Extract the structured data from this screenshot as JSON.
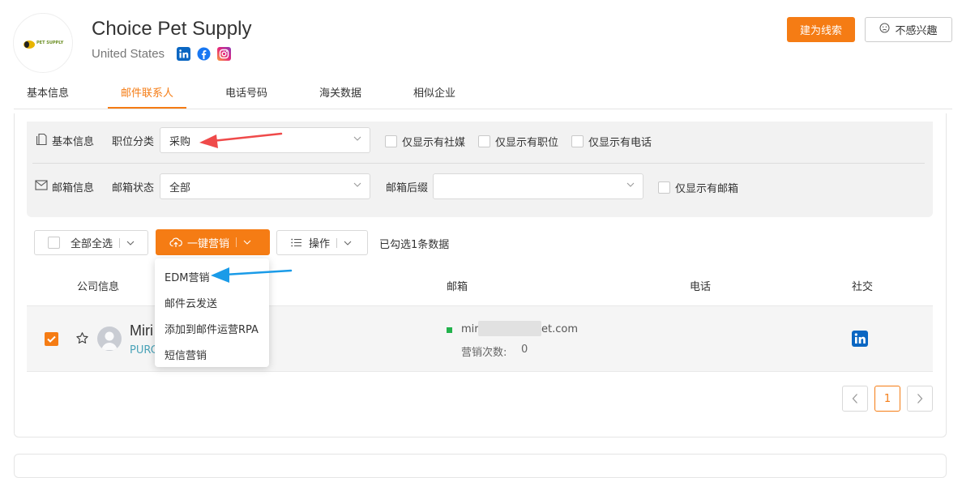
{
  "header": {
    "logo_text": "PET SUPPLY",
    "company_name": "Choice Pet Supply",
    "country": "United States",
    "buttons": {
      "create_lead": "建为线索",
      "not_interested": "不感兴趣"
    }
  },
  "tabs": [
    {
      "label": "基本信息"
    },
    {
      "label": "邮件联系人",
      "active": true
    },
    {
      "label": "电话号码"
    },
    {
      "label": "海关数据"
    },
    {
      "label": "相似企业"
    }
  ],
  "filters": {
    "basic": {
      "section_label": "基本信息",
      "position_label": "职位分类",
      "position_value": "采购",
      "checkboxes": [
        "仅显示有社媒",
        "仅显示有职位",
        "仅显示有电话"
      ]
    },
    "email": {
      "section_label": "邮箱信息",
      "status_label": "邮箱状态",
      "status_value": "全部",
      "suffix_label": "邮箱后缀",
      "suffix_value": "",
      "checkbox": "仅显示有邮箱"
    }
  },
  "toolbar": {
    "select_all": "全部全选",
    "one_click_marketing": "一键营销",
    "operations": "操作",
    "selected_info": "已勾选1条数据"
  },
  "dropdown": {
    "items": [
      "EDM营销",
      "邮件云发送",
      "添加到邮件运营RPA",
      "短信营销"
    ]
  },
  "table": {
    "headers": {
      "company": "公司信息",
      "email": "邮箱",
      "phone": "电话",
      "social": "社交"
    },
    "rows": [
      {
        "name": "Miri",
        "title": "PURC",
        "email_prefix": "mir",
        "email_suffix": "et.com",
        "marketing_count_label": "营销次数:",
        "marketing_count": "0",
        "phone": ""
      }
    ]
  },
  "pagination": {
    "current": "1"
  },
  "colors": {
    "accent": "#f57c14",
    "linkedin": "#0a66c2",
    "email_ok": "#22b24c"
  },
  "icons": [
    "linkedin-icon",
    "facebook-icon",
    "instagram-icon",
    "sad-face-icon",
    "document-icon",
    "mail-icon",
    "cloud-upload-icon",
    "list-icon",
    "chevron-down-icon",
    "star-icon",
    "user-avatar-icon"
  ]
}
